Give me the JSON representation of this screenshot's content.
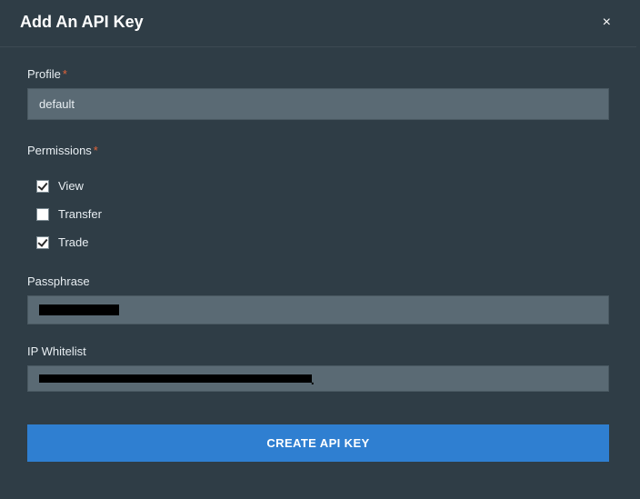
{
  "header": {
    "title": "Add An API Key",
    "close_glyph": "×"
  },
  "profile": {
    "label": "Profile",
    "required": true,
    "value": "default"
  },
  "permissions": {
    "label": "Permissions",
    "required": true,
    "items": [
      {
        "label": "View",
        "checked": true
      },
      {
        "label": "Transfer",
        "checked": false
      },
      {
        "label": "Trade",
        "checked": true
      }
    ]
  },
  "passphrase": {
    "label": "Passphrase",
    "required": false,
    "value_redacted": true
  },
  "ip_whitelist": {
    "label": "IP Whitelist",
    "required": false,
    "value_redacted": true
  },
  "submit": {
    "label": "CREATE API KEY"
  },
  "required_glyph": "*"
}
